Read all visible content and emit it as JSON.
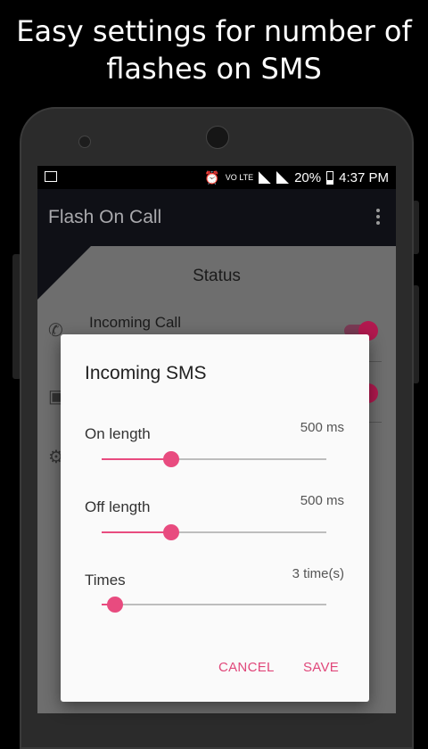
{
  "headline": "Easy settings for number of flashes on SMS",
  "status_bar": {
    "battery": "20%",
    "time": "4:37 PM",
    "volte": "VO LTE"
  },
  "app": {
    "title": "Flash On Call",
    "menu_icon": "overflow-menu-icon"
  },
  "main": {
    "section_heading": "Status",
    "rows": [
      {
        "label": "Incoming Call",
        "icon": "phone-icon",
        "enabled": true
      },
      {
        "label": "",
        "icon": "message-icon",
        "enabled": true
      },
      {
        "label": "",
        "icon": "gear-icon",
        "enabled": false
      }
    ]
  },
  "dialog": {
    "title": "Incoming SMS",
    "on_length": {
      "label": "On length",
      "value_text": "500 ms",
      "fraction": 0.31
    },
    "off_length": {
      "label": "Off length",
      "value_text": "500 ms",
      "fraction": 0.31
    },
    "times": {
      "label": "Times",
      "value_text": "3 time(s)",
      "fraction": 0.06
    },
    "cancel_label": "CANCEL",
    "save_label": "SAVE"
  },
  "colors": {
    "accent": "#e84b7f",
    "app_bar": "#0f1016",
    "switch_on": "#b2194f"
  }
}
